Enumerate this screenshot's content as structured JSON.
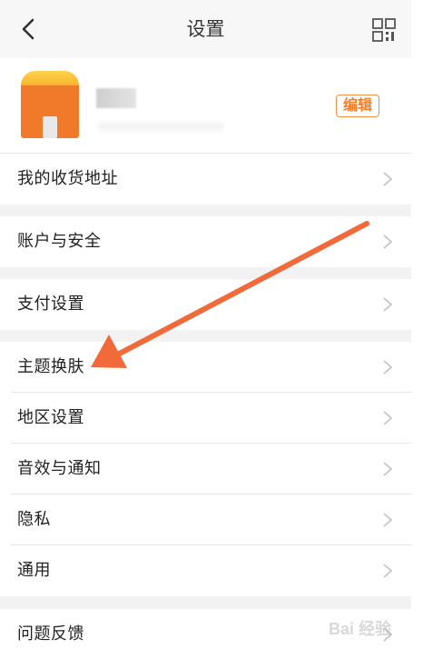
{
  "header": {
    "title": "设置",
    "back_icon": "chevron-left-icon",
    "qr_icon": "qr-code-icon"
  },
  "profile": {
    "edit_label": "编辑",
    "accent_color": "#f37f2a"
  },
  "menu_groups": [
    {
      "items": [
        {
          "label": "我的收货地址"
        }
      ]
    },
    {
      "items": [
        {
          "label": "账户与安全"
        }
      ]
    },
    {
      "items": [
        {
          "label": "支付设置"
        }
      ]
    },
    {
      "items": [
        {
          "label": "主题换肤"
        },
        {
          "label": "地区设置"
        },
        {
          "label": "音效与通知"
        },
        {
          "label": "隐私"
        },
        {
          "label": "通用"
        }
      ]
    },
    {
      "items": [
        {
          "label": "问题反馈"
        }
      ]
    }
  ],
  "annotation": {
    "arrow_color": "#f26a3a",
    "points_to": "主题换肤"
  },
  "watermark": {
    "text": "Bai 经验"
  }
}
